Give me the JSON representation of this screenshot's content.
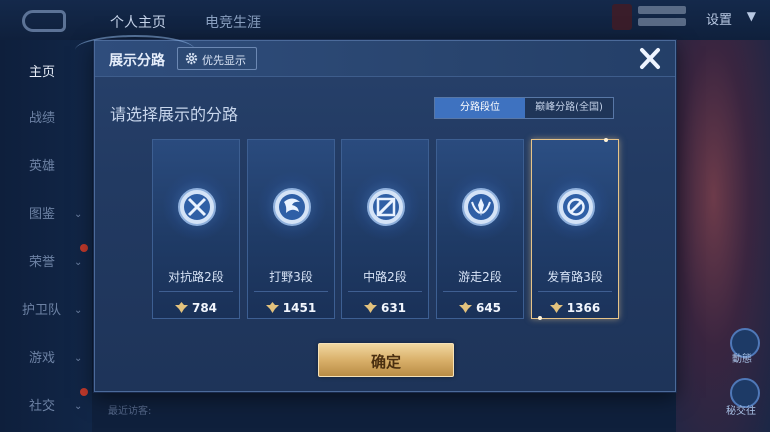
{
  "background": {
    "tabs": [
      "个人主页",
      "电竞生涯"
    ],
    "settings_label": "设置",
    "recent_visitors_label": "最近访客:",
    "sidebar": [
      {
        "label": "主页",
        "active": true,
        "chevron": false
      },
      {
        "label": "战绩",
        "active": false,
        "chevron": false
      },
      {
        "label": "英雄",
        "active": false,
        "chevron": false
      },
      {
        "label": "图鉴",
        "active": false,
        "chevron": true
      },
      {
        "label": "荣誉",
        "active": false,
        "chevron": true
      },
      {
        "label": "护卫队",
        "active": false,
        "chevron": true
      },
      {
        "label": "游戏",
        "active": false,
        "chevron": true
      },
      {
        "label": "社交",
        "active": false,
        "chevron": true
      }
    ],
    "right_buttons": [
      "動態",
      "秘交往"
    ]
  },
  "modal": {
    "title": "展示分路",
    "priority_button": "优先显示",
    "subtitle": "请选择展示的分路",
    "segments": [
      {
        "label": "分路段位",
        "active": true
      },
      {
        "label": "巅峰分路(全国)",
        "active": false
      }
    ],
    "lanes": [
      {
        "name": "对抗路2段",
        "score": "784",
        "icon": "clash-lane-icon",
        "selected": false
      },
      {
        "name": "打野3段",
        "score": "1451",
        "icon": "jungle-icon",
        "selected": false
      },
      {
        "name": "中路2段",
        "score": "631",
        "icon": "mid-lane-icon",
        "selected": false
      },
      {
        "name": "游走2段",
        "score": "645",
        "icon": "roam-icon",
        "selected": false
      },
      {
        "name": "发育路3段",
        "score": "1366",
        "icon": "farm-lane-icon",
        "selected": true
      }
    ],
    "confirm_label": "确定"
  },
  "colors": {
    "accent_blue": "#3e72c0",
    "gold": "#d9b06a",
    "selected_border": "#e6c489"
  }
}
